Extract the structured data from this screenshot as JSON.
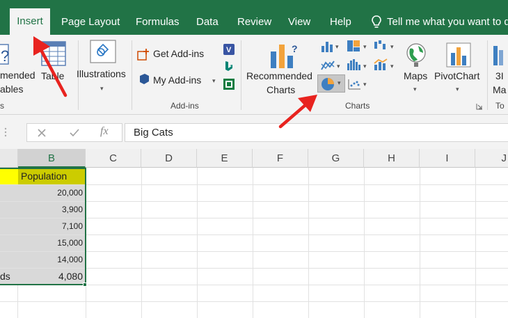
{
  "tabs": {
    "insert": "Insert",
    "page_layout": "Page Layout",
    "formulas": "Formulas",
    "data": "Data",
    "review": "Review",
    "view": "View",
    "help": "Help",
    "tell_me": "Tell me what you want to d"
  },
  "ribbon": {
    "recommended_pivot_line1": "mended",
    "recommended_pivot_line2": "ables",
    "table_label": "Table",
    "tables_group_label": "s",
    "illustrations_label": "Illustrations",
    "get_addins_label": "Get Add-ins",
    "my_addins_label": "My Add-ins",
    "addins_group_label": "Add-ins",
    "recommended_charts_line1": "Recommended",
    "recommended_charts_line2": "Charts",
    "maps_label": "Maps",
    "pivotchart_label": "PivotChart",
    "charts_group_label": "Charts",
    "threed_map_line1": "3I",
    "threed_map_line2": "Ma",
    "tours_group_label": "To"
  },
  "formula_bar": {
    "fx_label": "fx",
    "content": "Big Cats"
  },
  "grid": {
    "columns": [
      "B",
      "C",
      "D",
      "E",
      "F",
      "G",
      "H",
      "I",
      "J"
    ],
    "header_cell": "Population",
    "values": [
      "20,000",
      "3,900",
      "7,100",
      "15,000",
      "14,000",
      "4,080"
    ],
    "partial_last_label": "ds"
  },
  "colors": {
    "excel_green": "#217346",
    "header_yellow": "#ffff00",
    "population_header": "#cccc00",
    "arrow_red": "#e8231f"
  }
}
